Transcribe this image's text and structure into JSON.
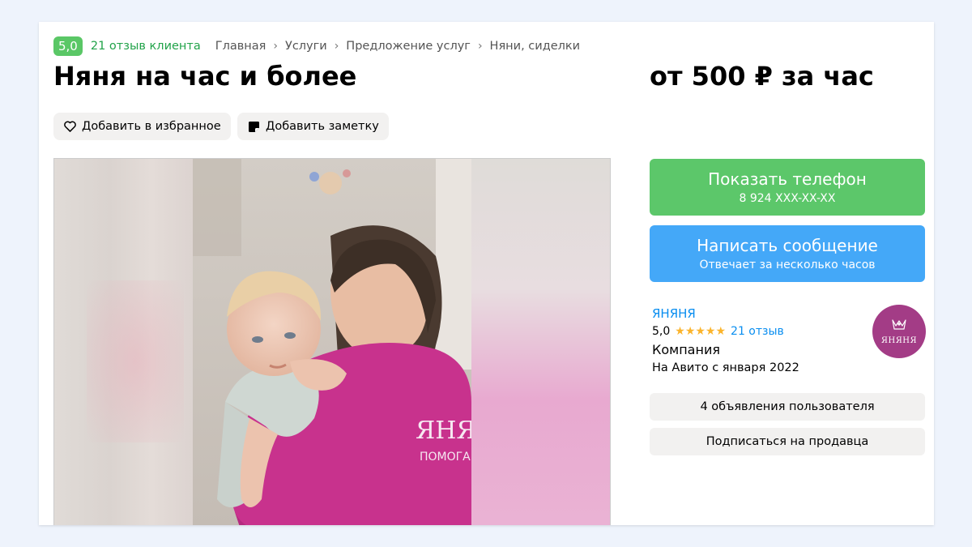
{
  "header": {
    "rating": "5,0",
    "reviews_link": "21 отзыв клиента",
    "breadcrumbs": [
      "Главная",
      "Услуги",
      "Предложение услуг",
      "Няни, сиделки"
    ]
  },
  "listing": {
    "title": "Няня на час и более",
    "price": "от 500 ₽ за час",
    "favorite_label": "Добавить в избранное",
    "note_label": "Добавить заметку"
  },
  "photo": {
    "shirt_text_line1": "ЯНЯ",
    "shirt_text_line2": "ПОМОГАН"
  },
  "contact": {
    "phone_label": "Показать телефон",
    "phone_number": "8 924 XXX-XX-XX",
    "message_label": "Написать сообщение",
    "message_sub": "Отвечает за несколько часов"
  },
  "seller": {
    "name": "ЯНЯНЯ",
    "rating": "5,0",
    "stars": "★★★★★",
    "reviews": "21 отзыв",
    "type": "Компания",
    "since": "На Авито с января 2022",
    "avatar_text": "ЯНЯНЯ",
    "listings_label": "4 объявления пользователя",
    "subscribe_label": "Подписаться на продавца"
  },
  "colors": {
    "green": "#5cc76a",
    "blue": "#44a8f8",
    "link_blue": "#0a8ef0",
    "star": "#fbb42c",
    "brand_magenta": "#a33c86"
  },
  "icons": [
    "heart-icon",
    "note-icon",
    "chevron-right-icon",
    "star-icon",
    "logo-icon"
  ]
}
